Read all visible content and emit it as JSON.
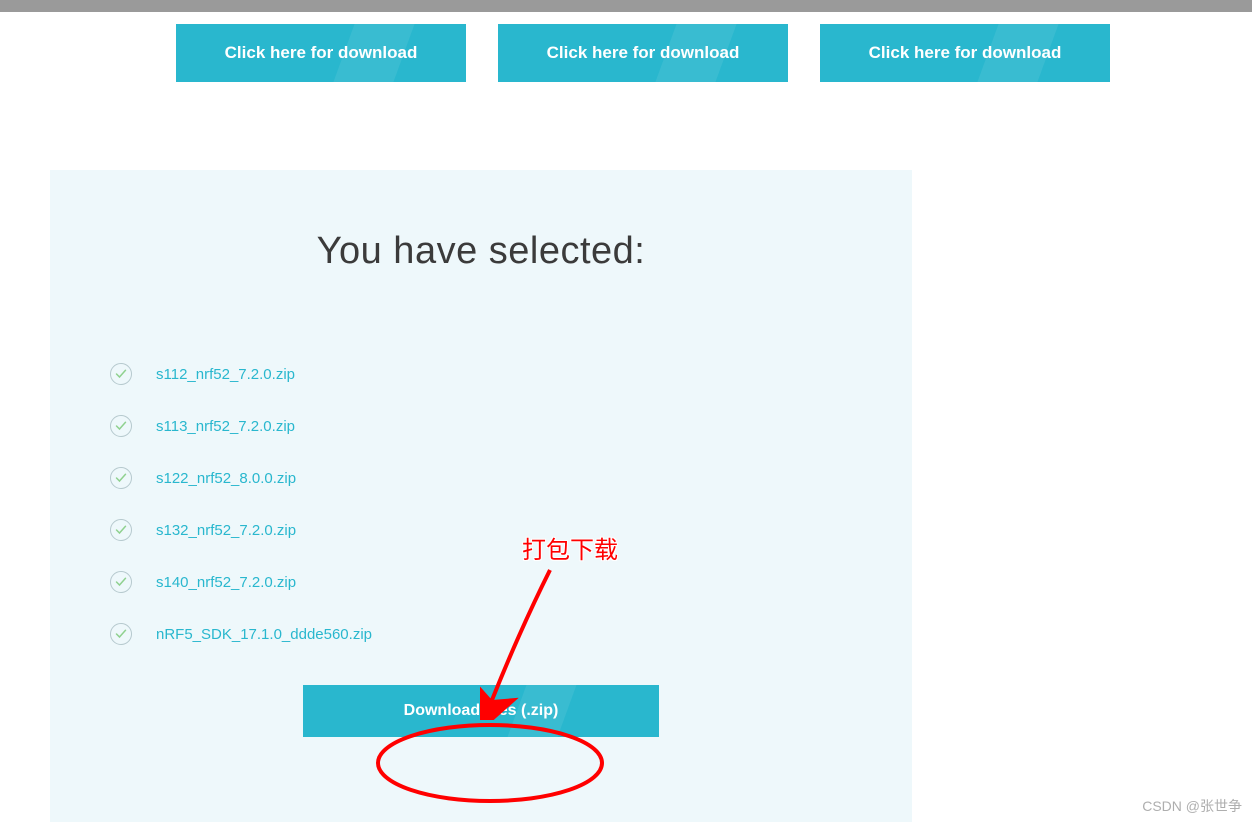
{
  "top_buttons": {
    "btn1": "Click here for download",
    "btn2": "Click here for download",
    "btn3": "Click here for download"
  },
  "panel": {
    "title": "You have selected:",
    "files": {
      "f0": "s112_nrf52_7.2.0.zip",
      "f1": "s113_nrf52_7.2.0.zip",
      "f2": "s122_nrf52_8.0.0.zip",
      "f3": "s132_nrf52_7.2.0.zip",
      "f4": "s140_nrf52_7.2.0.zip",
      "f5": "nRF5_SDK_17.1.0_ddde560.zip"
    },
    "download_button": "Download files (.zip)"
  },
  "annotation": {
    "label": "打包下载"
  },
  "watermark": "CSDN @张世争"
}
